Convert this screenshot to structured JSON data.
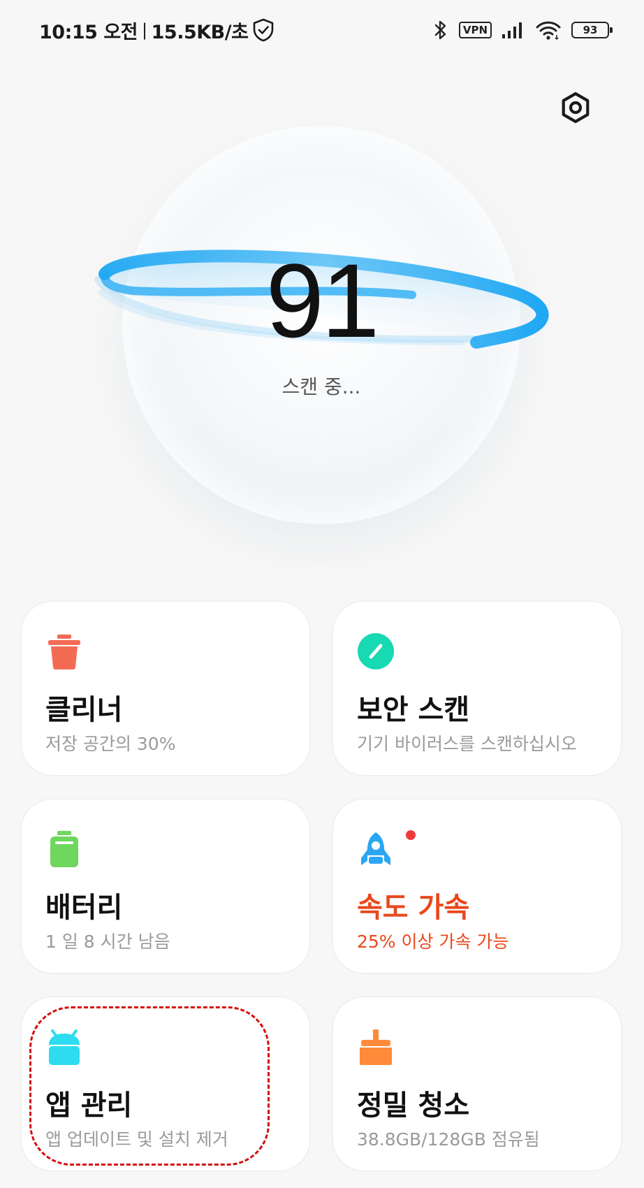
{
  "status_bar": {
    "time": "10:15 오전",
    "separator": "|",
    "net_speed": "15.5KB/초",
    "vpn_label": "VPN",
    "battery_level": "93"
  },
  "header": {
    "settings_icon": "settings-hex-icon"
  },
  "scan": {
    "score": "91",
    "status": "스캔 중..."
  },
  "cards": [
    {
      "id": "cleaner",
      "icon": "trash-icon",
      "title": "클리너",
      "subtitle": "저장 공간의 30%",
      "color": "#f46b54"
    },
    {
      "id": "security-scan",
      "icon": "security-gauge-icon",
      "title": "보안 스캔",
      "subtitle": "기기 바이러스를 스캔하십시오",
      "color": "#17d9b2"
    },
    {
      "id": "battery",
      "icon": "battery-icon",
      "title": "배터리",
      "subtitle": "1 일 8 시간  남음",
      "color": "#6fd65e"
    },
    {
      "id": "speed-boost",
      "icon": "rocket-icon",
      "title": "속도 가속",
      "subtitle": "25% 이상 가속 가능",
      "color": "#2aa6f2",
      "accent": "#e8491d"
    },
    {
      "id": "app-manager",
      "icon": "android-icon",
      "title": "앱 관리",
      "subtitle": "앱 업데이트 및 설치 제거",
      "color": "#2ddcf0"
    },
    {
      "id": "deep-clean",
      "icon": "broom-icon",
      "title": "정밀 청소",
      "subtitle": "38.8GB/128GB 점유됨",
      "color": "#ff8a3a"
    }
  ],
  "ring_color": "#1fa8f3",
  "highlight_color": "#d40e0e"
}
